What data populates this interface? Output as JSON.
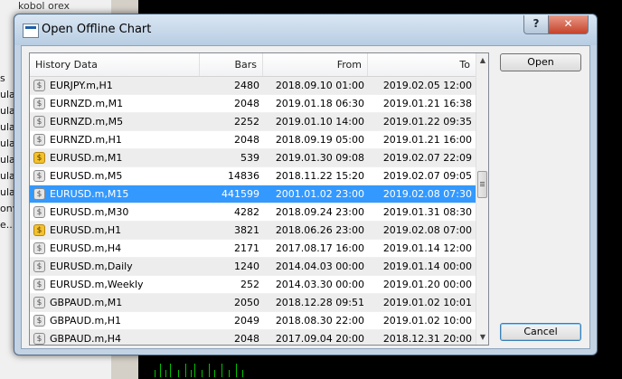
{
  "background": {
    "title_fragment": "kobol orex",
    "items": [
      "s",
      "ula",
      "ula",
      "ula",
      "ula",
      "ula",
      "ula",
      "ula",
      "onv",
      "e..."
    ]
  },
  "dialog": {
    "title": "Open Offline Chart",
    "help_label": "?",
    "close_label": "✕"
  },
  "table": {
    "columns": [
      "History Data",
      "Bars",
      "From",
      "To"
    ],
    "rows": [
      {
        "name": "EURJPY.m,H1",
        "bars": "2480",
        "from": "2018.09.10 01:00",
        "to": "2019.02.05 12:00",
        "icon": "gray"
      },
      {
        "name": "EURNZD.m,M1",
        "bars": "2048",
        "from": "2019.01.18 06:30",
        "to": "2019.01.21 16:38",
        "icon": "gray"
      },
      {
        "name": "EURNZD.m,M5",
        "bars": "2252",
        "from": "2019.01.10 14:00",
        "to": "2019.01.22 09:35",
        "icon": "gray"
      },
      {
        "name": "EURNZD.m,H1",
        "bars": "2048",
        "from": "2018.09.19 05:00",
        "to": "2019.01.21 16:00",
        "icon": "gray"
      },
      {
        "name": "EURUSD.m,M1",
        "bars": "539",
        "from": "2019.01.30 09:08",
        "to": "2019.02.07 22:09",
        "icon": "gold"
      },
      {
        "name": "EURUSD.m,M5",
        "bars": "14836",
        "from": "2018.11.22 15:20",
        "to": "2019.02.07 09:05",
        "icon": "gray"
      },
      {
        "name": "EURUSD.m,M15",
        "bars": "441599",
        "from": "2001.01.02 23:00",
        "to": "2019.02.08 07:30",
        "icon": "gray",
        "selected": true
      },
      {
        "name": "EURUSD.m,M30",
        "bars": "4282",
        "from": "2018.09.24 23:00",
        "to": "2019.01.31 08:30",
        "icon": "gray"
      },
      {
        "name": "EURUSD.m,H1",
        "bars": "3821",
        "from": "2018.06.26 23:00",
        "to": "2019.02.08 07:00",
        "icon": "gold"
      },
      {
        "name": "EURUSD.m,H4",
        "bars": "2171",
        "from": "2017.08.17 16:00",
        "to": "2019.01.14 12:00",
        "icon": "gray"
      },
      {
        "name": "EURUSD.m,Daily",
        "bars": "1240",
        "from": "2014.04.03 00:00",
        "to": "2019.01.14 00:00",
        "icon": "gray"
      },
      {
        "name": "EURUSD.m,Weekly",
        "bars": "252",
        "from": "2014.03.30 00:00",
        "to": "2019.01.20 00:00",
        "icon": "gray"
      },
      {
        "name": "GBPAUD.m,M1",
        "bars": "2050",
        "from": "2018.12.28 09:51",
        "to": "2019.01.02 10:01",
        "icon": "gray"
      },
      {
        "name": "GBPAUD.m,H1",
        "bars": "2049",
        "from": "2018.08.30 22:00",
        "to": "2019.01.02 10:00",
        "icon": "gray"
      },
      {
        "name": "GBPAUD.m,H4",
        "bars": "2048",
        "from": "2017.09.04 20:00",
        "to": "2018.12.31 20:00",
        "icon": "gray"
      }
    ]
  },
  "buttons": {
    "open": "Open",
    "cancel": "Cancel"
  },
  "icons": {
    "symbol_icon": "dollar-coin-icon",
    "symbol_glyph": "$"
  },
  "colors": {
    "selection": "#3399ff",
    "symbol_active": "#f2c230",
    "titlebar": "#c3d3e4",
    "close": "#c6432c"
  }
}
